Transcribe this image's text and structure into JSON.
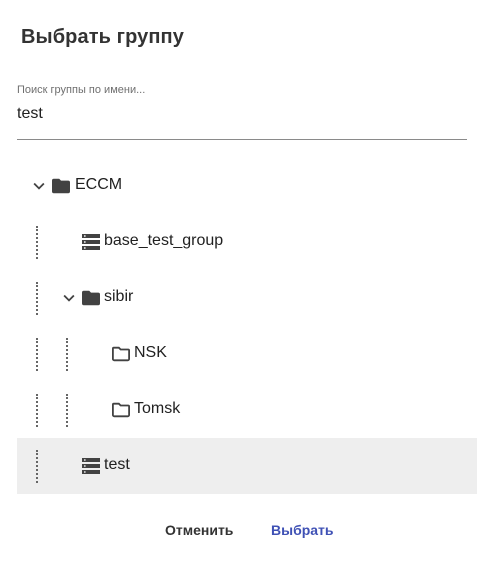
{
  "dialog": {
    "title": "Выбрать группу",
    "search": {
      "label": "Поиск группы по имени...",
      "value": "test"
    },
    "tree": {
      "nodes": [
        {
          "label": "ECCM",
          "type": "folder",
          "expanded": true,
          "depth": 0,
          "selected": false
        },
        {
          "label": "base_test_group",
          "type": "group",
          "depth": 1,
          "selected": false
        },
        {
          "label": "sibir",
          "type": "folder",
          "expanded": true,
          "depth": 1,
          "selected": false
        },
        {
          "label": "NSK",
          "type": "folder",
          "expanded": false,
          "depth": 2,
          "selected": false
        },
        {
          "label": "Tomsk",
          "type": "folder",
          "expanded": false,
          "depth": 2,
          "selected": false
        },
        {
          "label": "test",
          "type": "group",
          "depth": 1,
          "selected": true
        }
      ]
    },
    "actions": {
      "cancel_label": "Отменить",
      "ok_label": "Выбрать"
    },
    "colors": {
      "accent": "#3f51b5",
      "selected_row": "#eeeeee",
      "icon": "#424242"
    }
  }
}
